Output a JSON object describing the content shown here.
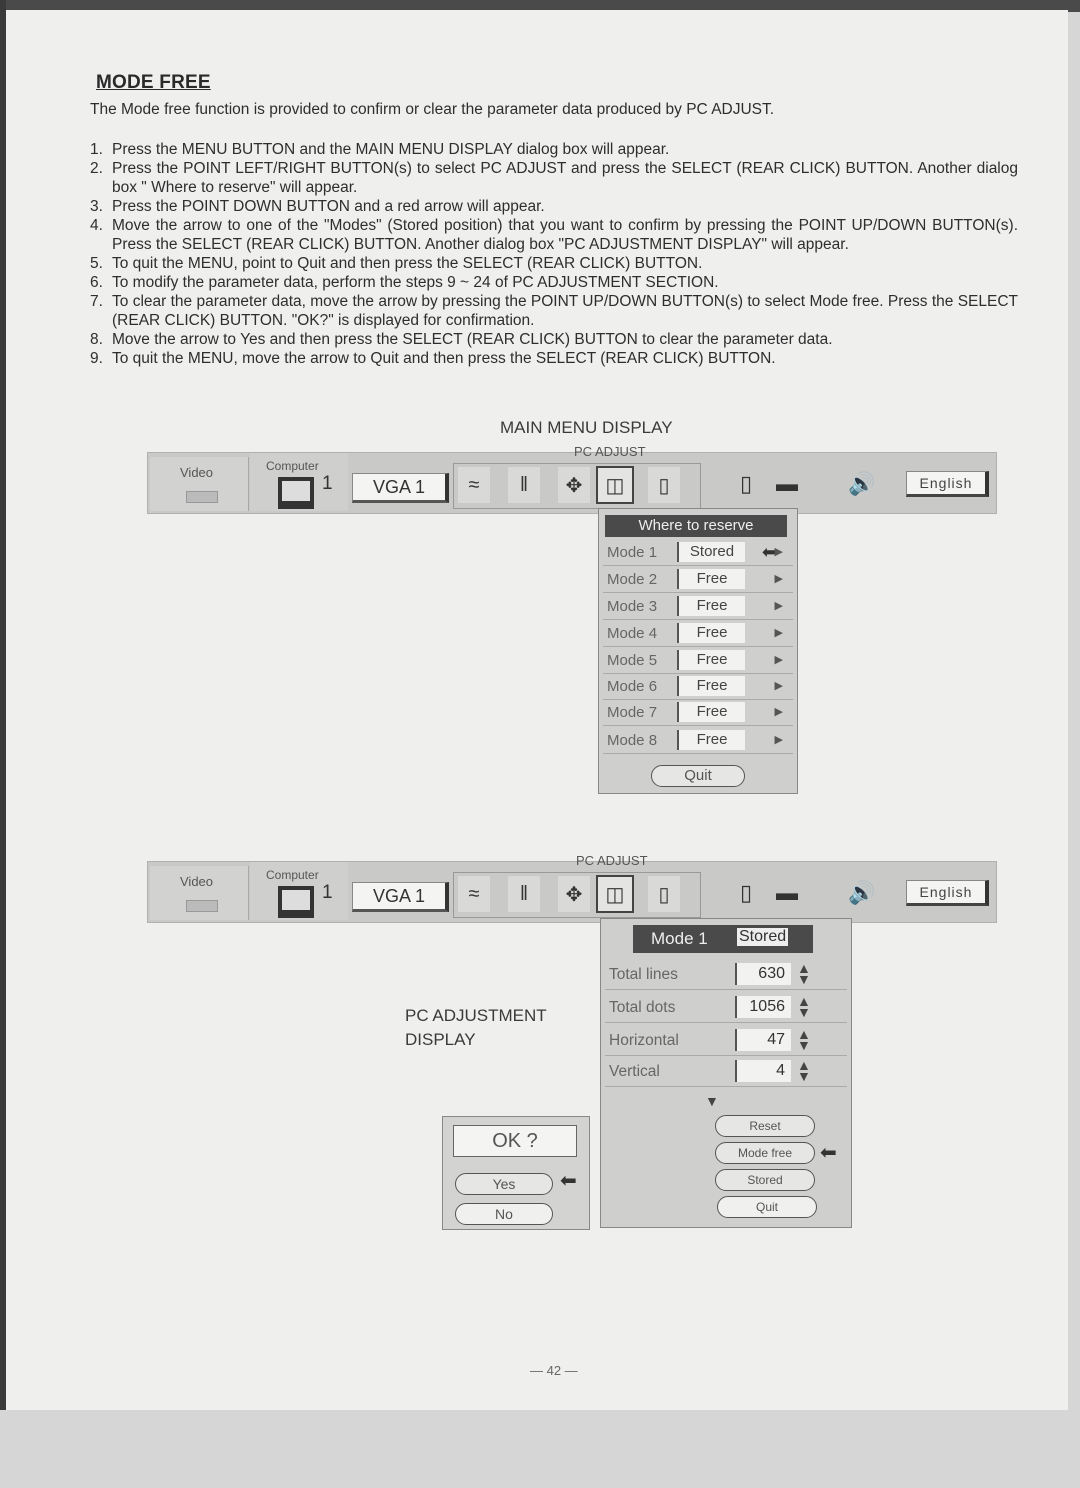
{
  "document": {
    "title": "MODE FREE",
    "intro": "The Mode free function is provided to confirm or clear the parameter data produced by PC ADJUST.",
    "steps": [
      {
        "num": "1.",
        "text": "Press the MENU BUTTON and the MAIN MENU DISPLAY dialog box will appear."
      },
      {
        "num": "2.",
        "text": "Press the POINT LEFT/RIGHT BUTTON(s) to select PC ADJUST and press the SELECT (REAR CLICK) BUTTON. Another dialog box \" Where to reserve\" will appear."
      },
      {
        "num": "3.",
        "text": "Press the POINT DOWN BUTTON and a red arrow will appear."
      },
      {
        "num": "4.",
        "text": "Move the arrow to one of the \"Modes\" (Stored position) that you want to confirm by pressing the POINT UP/DOWN BUTTON(s). Press the SELECT (REAR CLICK) BUTTON. Another dialog box \"PC ADJUSTMENT DISPLAY\" will appear."
      },
      {
        "num": "5.",
        "text": "To quit the MENU, point to Quit and then press the SELECT (REAR CLICK) BUTTON."
      },
      {
        "num": "6.",
        "text": "To modify the parameter data, perform the steps 9 ~ 24 of PC ADJUSTMENT SECTION."
      },
      {
        "num": "7.",
        "text": "To clear the parameter data, move the arrow by pressing the POINT UP/DOWN BUTTON(s) to select Mode free. Press the SELECT (REAR CLICK) BUTTON. \"OK?\" is displayed for confirmation."
      },
      {
        "num": "8.",
        "text": "Move the arrow to Yes and then press the SELECT (REAR CLICK) BUTTON to clear the parameter data."
      },
      {
        "num": "9.",
        "text": "To quit the MENU, move the arrow to Quit and then press the SELECT (REAR CLICK) BUTTON."
      }
    ],
    "page_number": "— 42 —"
  },
  "figure1": {
    "caption": "MAIN MENU DISPLAY",
    "menubar": {
      "video_label": "Video",
      "computer_label": "Computer",
      "computer_number": "1",
      "source": "VGA 1",
      "pc_adjust_label": "PC ADJUST",
      "icons": [
        "fine-sync-icon",
        "total-dots-icon",
        "position-icon",
        "pc-adjust-icon",
        "keystone-icon"
      ],
      "language": "English"
    },
    "reserve_dialog": {
      "title": "Where to reserve",
      "modes": [
        {
          "label": "Mode 1",
          "value": "Stored",
          "selected": true
        },
        {
          "label": "Mode 2",
          "value": "Free"
        },
        {
          "label": "Mode 3",
          "value": "Free"
        },
        {
          "label": "Mode 4",
          "value": "Free"
        },
        {
          "label": "Mode 5",
          "value": "Free"
        },
        {
          "label": "Mode 6",
          "value": "Free"
        },
        {
          "label": "Mode 7",
          "value": "Free"
        },
        {
          "label": "Mode 8",
          "value": "Free"
        }
      ],
      "quit_label": "Quit"
    }
  },
  "figure2": {
    "caption_line1": "PC ADJUSTMENT",
    "caption_line2": "DISPLAY",
    "menubar": {
      "video_label": "Video",
      "computer_label": "Computer",
      "computer_number": "1",
      "source": "VGA 1",
      "pc_adjust_label": "PC ADJUST",
      "language": "English"
    },
    "adjust_dialog": {
      "mode": "Mode 1",
      "status": "Stored",
      "params": [
        {
          "label": "Total lines",
          "value": "630"
        },
        {
          "label": "Total dots",
          "value": "1056"
        },
        {
          "label": "Horizontal",
          "value": "47"
        },
        {
          "label": "Vertical",
          "value": "4"
        }
      ],
      "buttons": {
        "reset": "Reset",
        "mode_free": "Mode free",
        "stored": "Stored",
        "quit": "Quit"
      }
    },
    "confirm_dialog": {
      "prompt": "OK ?",
      "yes": "Yes",
      "no": "No"
    }
  }
}
